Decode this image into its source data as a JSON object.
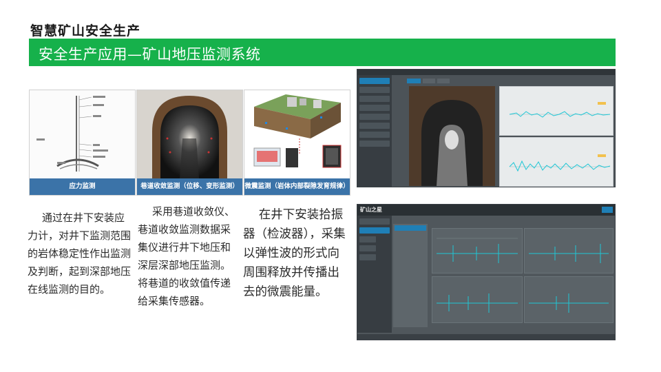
{
  "header": {
    "title": "智慧矿山安全生产",
    "subtitle": "安全生产应用—矿山地压监测系统"
  },
  "panels": [
    {
      "caption": "应力监测",
      "description": "通过在井下安装应力计，对井下监测范围的岩体稳定性作出监测及判断，起到深部地压在线监测的目的。"
    },
    {
      "caption": "巷道收敛监测（位移、变形监测）",
      "description": "采用巷道收敛仪、巷道收敛监测数据采集仪进行井下地压和深层深部地压监测。将巷道的收敛值传递给采集传感器。"
    },
    {
      "caption": "微震监测（岩体内部裂隙发育规律）",
      "description": "在井下安装拾振器（检波器），采集以弹性波的形式向周围释放并传播出去的微震能量。"
    }
  ],
  "screens": {
    "top": {
      "note": "monitoring dashboard"
    },
    "bottom": {
      "brand": "矿山之星"
    }
  },
  "colors": {
    "accent_green": "#16b14b",
    "caption_blue": "#3b73a8",
    "wave": "#1fc7d6"
  }
}
